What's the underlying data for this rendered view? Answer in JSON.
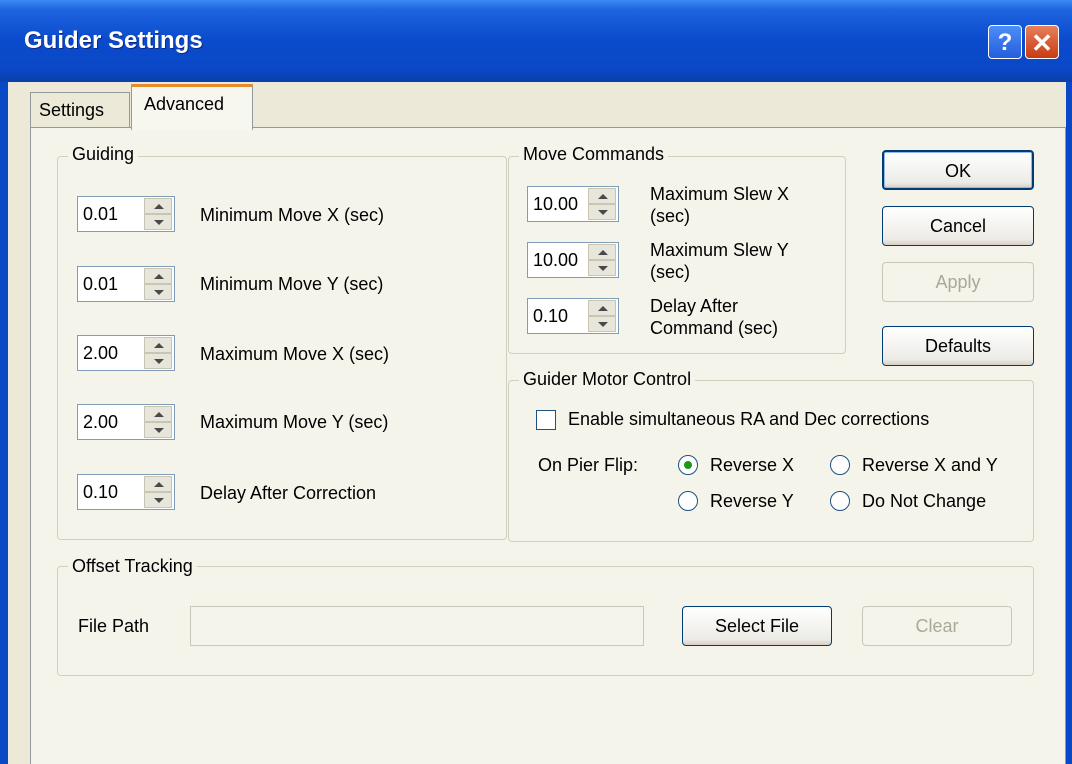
{
  "window": {
    "title": "Guider Settings",
    "help_glyph": "?",
    "close_glyph": "✕"
  },
  "tabs": [
    {
      "label": "Settings"
    },
    {
      "label": "Advanced"
    }
  ],
  "guiding": {
    "legend": "Guiding",
    "rows": [
      {
        "value": "0.01",
        "label": "Minimum Move X (sec)"
      },
      {
        "value": "0.01",
        "label": "Minimum Move Y (sec)"
      },
      {
        "value": "2.00",
        "label": "Maximum Move X (sec)"
      },
      {
        "value": "2.00",
        "label": "Maximum Move Y (sec)"
      },
      {
        "value": "0.10",
        "label": "Delay After Correction"
      }
    ]
  },
  "move_commands": {
    "legend": "Move Commands",
    "rows": [
      {
        "value": "10.00",
        "label_line1": "Maximum Slew X",
        "label_line2": "(sec)"
      },
      {
        "value": "10.00",
        "label_line1": "Maximum Slew Y",
        "label_line2": "(sec)"
      },
      {
        "value": "0.10",
        "label_line1": "Delay After",
        "label_line2": "Command (sec)"
      }
    ]
  },
  "buttons": {
    "ok": "OK",
    "cancel": "Cancel",
    "apply": "Apply",
    "defaults": "Defaults"
  },
  "motor_control": {
    "legend": "Guider Motor Control",
    "simultaneous_label": "Enable simultaneous RA and Dec corrections",
    "simultaneous_checked": false,
    "pier_flip_label": "On Pier Flip:",
    "options": [
      {
        "label": "Reverse X",
        "selected": true
      },
      {
        "label": "Reverse X and Y",
        "selected": false
      },
      {
        "label": "Reverse Y",
        "selected": false
      },
      {
        "label": "Do Not Change",
        "selected": false
      }
    ]
  },
  "offset_tracking": {
    "legend": "Offset Tracking",
    "file_path_label": "File Path",
    "file_path_value": "",
    "select_file": "Select File",
    "clear": "Clear"
  },
  "colors": {
    "title_bar": "#0A48C6",
    "dialog_bg": "#ECE9D8",
    "tab_accent": "#E68B2C",
    "radio_dot": "#1A9A1A"
  }
}
